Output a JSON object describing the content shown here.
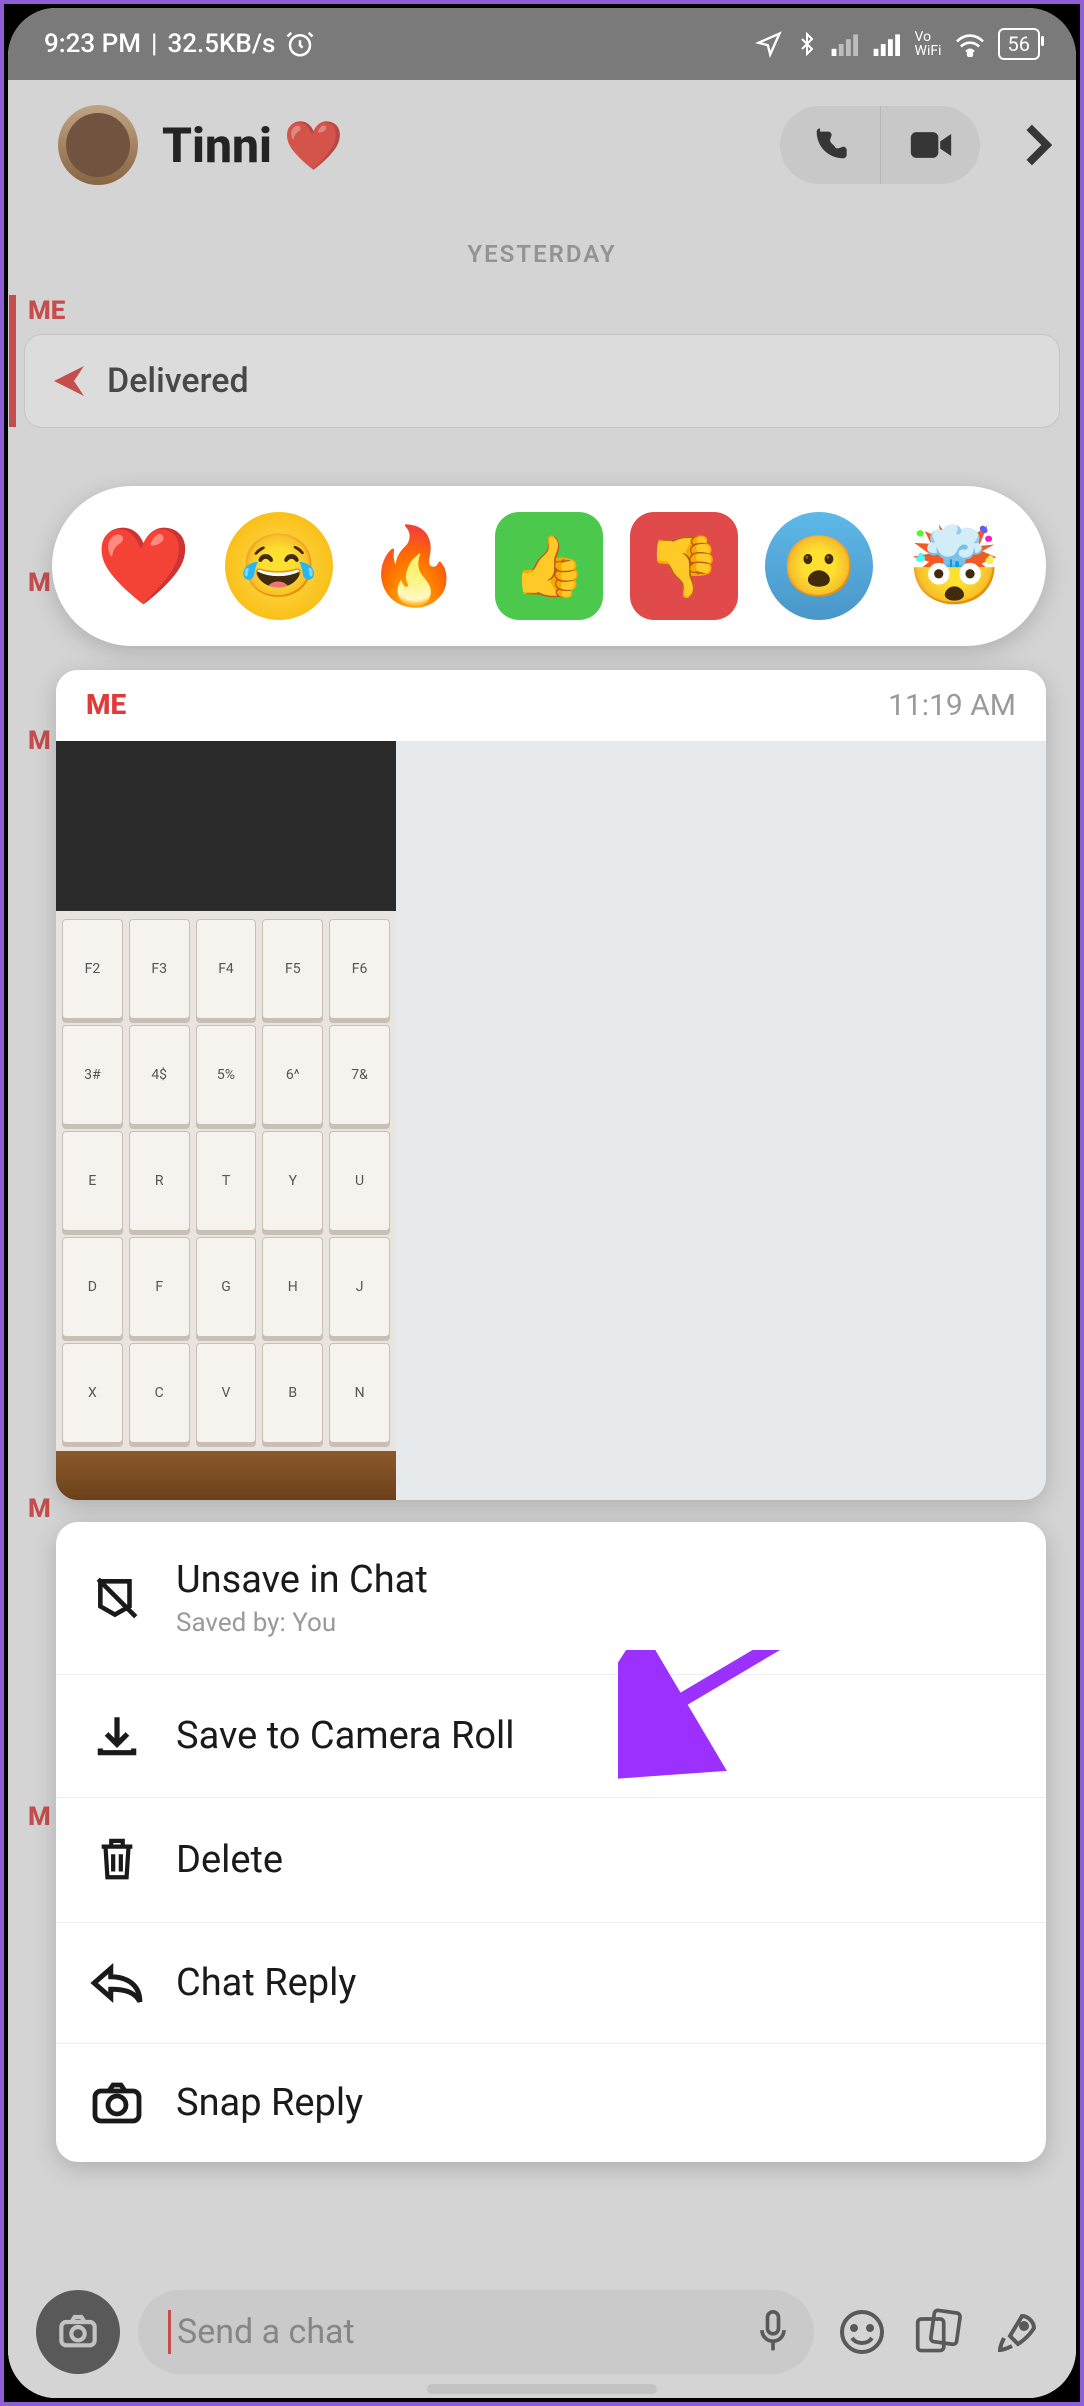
{
  "status": {
    "time": "9:23 PM",
    "net_speed": "32.5KB/s",
    "vo": "Vo",
    "wifi_label": "WiFi",
    "battery": "56"
  },
  "header": {
    "contact_name": "Tinni",
    "heart_emoji": "❤️"
  },
  "date_separator": "YESTERDAY",
  "sender_label": "ME",
  "delivered_text": "Delivered",
  "preview": {
    "sender": "ME",
    "time": "11:19 AM"
  },
  "reactions": {
    "heart": "❤️",
    "laugh": "😂",
    "fire": "🔥",
    "thumbs_up": "👍",
    "thumbs_down": "👎",
    "wow": "😮",
    "mind_blown": "🤯"
  },
  "sheet": {
    "unsave": "Unsave in Chat",
    "unsave_sub": "Saved by: You",
    "save_roll": "Save to Camera Roll",
    "delete": "Delete",
    "chat_reply": "Chat Reply",
    "snap_reply": "Snap Reply"
  },
  "composer": {
    "placeholder": "Send a chat"
  }
}
